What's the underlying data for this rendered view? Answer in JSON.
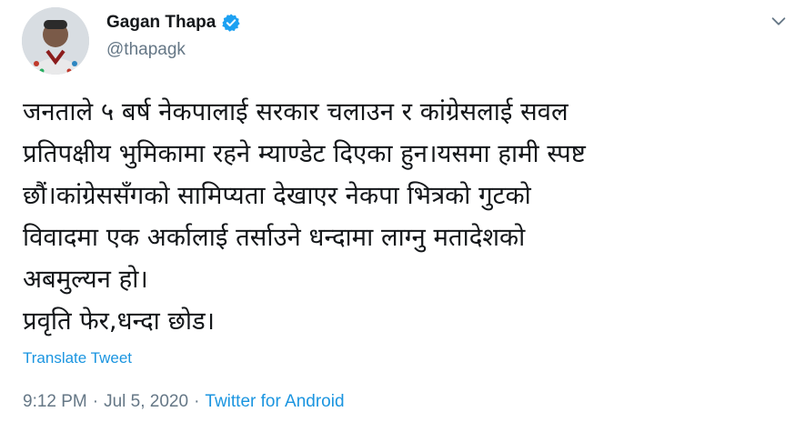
{
  "author": {
    "name": "Gagan Thapa",
    "handle": "@thapagk",
    "verified": true
  },
  "tweet": {
    "lines": [
      "जनताले ५ बर्ष नेकपालाई सरकार चलाउन र कांग्रेसलाई सवल",
      "प्रतिपक्षीय भुमिकामा रहने म्याण्डेट दिएका हुन।यसमा हामी स्पष्ट",
      "छौं।कांग्रेससँगको सामिप्यता देखाएर नेकपा भित्रको गुटको",
      "विवादमा एक अर्कालाई तर्साउने धन्दामा लाग्नु मतादेशको",
      "अबमुल्यन हो।",
      "प्रवृति फेर,धन्दा छोड।"
    ],
    "translate_label": "Translate Tweet",
    "time": "9:12 PM",
    "date": "Jul 5, 2020",
    "separator": "·",
    "source": "Twitter for Android"
  },
  "icons": {
    "verified": "verified-badge-icon",
    "more": "chevron-down-icon"
  },
  "colors": {
    "link": "#1b95e0",
    "secondary": "#657786",
    "text": "#14171a",
    "verified": "#1da1f2"
  }
}
